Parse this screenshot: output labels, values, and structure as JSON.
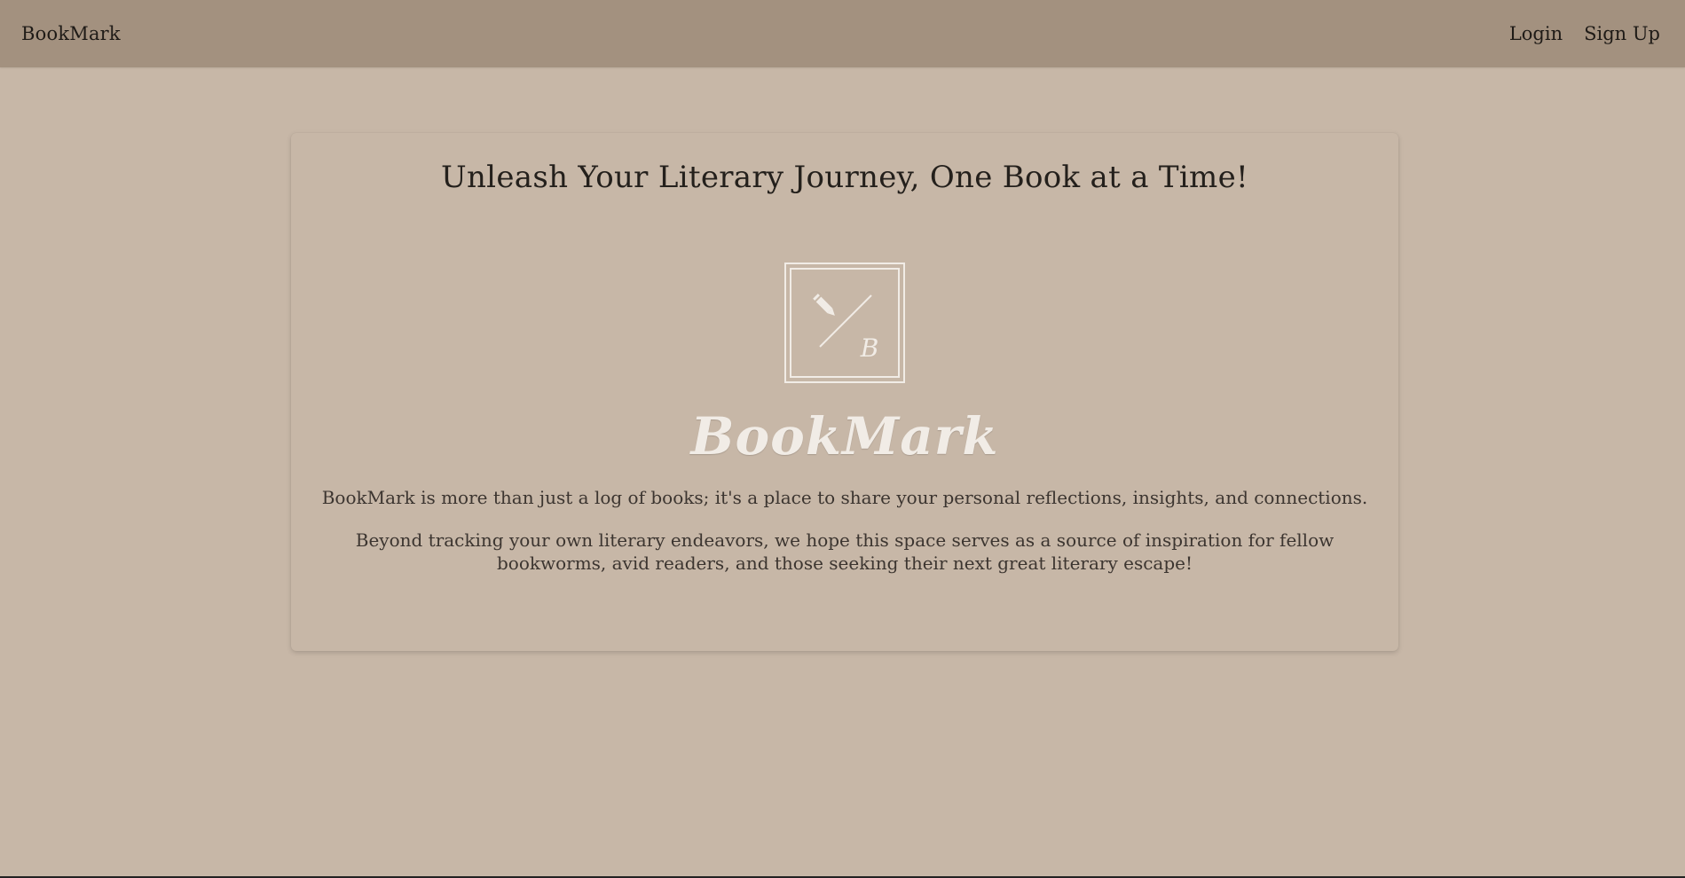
{
  "navbar": {
    "brand": "BookMark",
    "links": [
      {
        "label": "Login"
      },
      {
        "label": "Sign Up"
      }
    ]
  },
  "hero": {
    "headline": "Unleash Your Literary Journey, One Book at a Time!",
    "logo_letter": "B",
    "logo_word": "BookMark",
    "description": "BookMark is more than just a log of books; it's a place to share your personal reflections, insights, and connections.",
    "description2": "Beyond tracking your own literary endeavors, we hope this space serves as a source of inspiration for fellow bookworms, avid readers, and those seeking their next great literary escape!"
  },
  "colors": {
    "page_bg": "#c7b7a7",
    "navbar_bg": "#a3917f",
    "logo_color": "#f1ece6"
  },
  "icons": [
    "pencil-icon"
  ]
}
